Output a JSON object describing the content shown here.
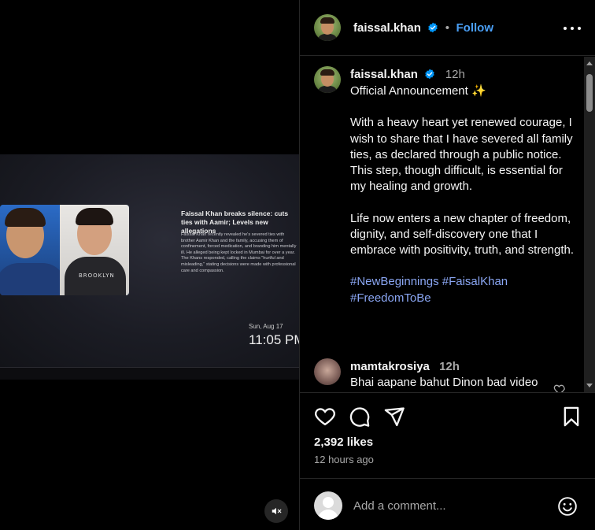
{
  "media": {
    "news": {
      "headline": "Faissal Khan breaks silence: cuts ties with Aamir; Levels new allegations",
      "body": "Faissal Khan recently revealed he's severed ties with brother Aamir Khan and the family, accusing them of confinement, forced medication, and branding him mentally ill. He alleged being kept locked in Mumbai for over a year. The Khans responded, calling the claims \"hurtful and misleading,\" stating decisions were made with professional care and compassion.",
      "shirt_print": "BROOKLYN"
    },
    "tv_date": "Sun, Aug 17",
    "tv_time": "11:05 PM",
    "mute_icon": "muted-speaker-icon"
  },
  "header": {
    "username": "faissal.khan",
    "separator": "•",
    "follow_label": "Follow",
    "verified_color": "#0095f6"
  },
  "caption": {
    "username": "faissal.khan",
    "time": "12h",
    "title": "Official Announcement ✨",
    "paragraph1": "With a heavy heart yet renewed courage, I wish to share that I have severed all family ties, as declared through a public notice. This step, though difficult, is essential for my healing and growth.",
    "paragraph2": "Life now enters a new chapter of freedom, dignity, and self-discovery one that I embrace with positivity, truth, and strength.",
    "hashtag1": "#NewBeginnings",
    "hashtag2": "#FaisalKhan",
    "hashtag3": "#FreedomToBe"
  },
  "comments": [
    {
      "username": "mamtakrosiya",
      "time": "12h",
      "text": "Bhai aapane bahut Dinon bad video"
    }
  ],
  "actions": {
    "likes": "2,392 likes",
    "posted": "12 hours ago"
  },
  "add_comment": {
    "placeholder": "Add a comment..."
  },
  "colors": {
    "background": "#000000",
    "text": "#f5f5f5",
    "muted": "#a8a8a8",
    "link": "#4a9ff5",
    "hashtag": "#8aa6f3",
    "divider": "#262626"
  }
}
